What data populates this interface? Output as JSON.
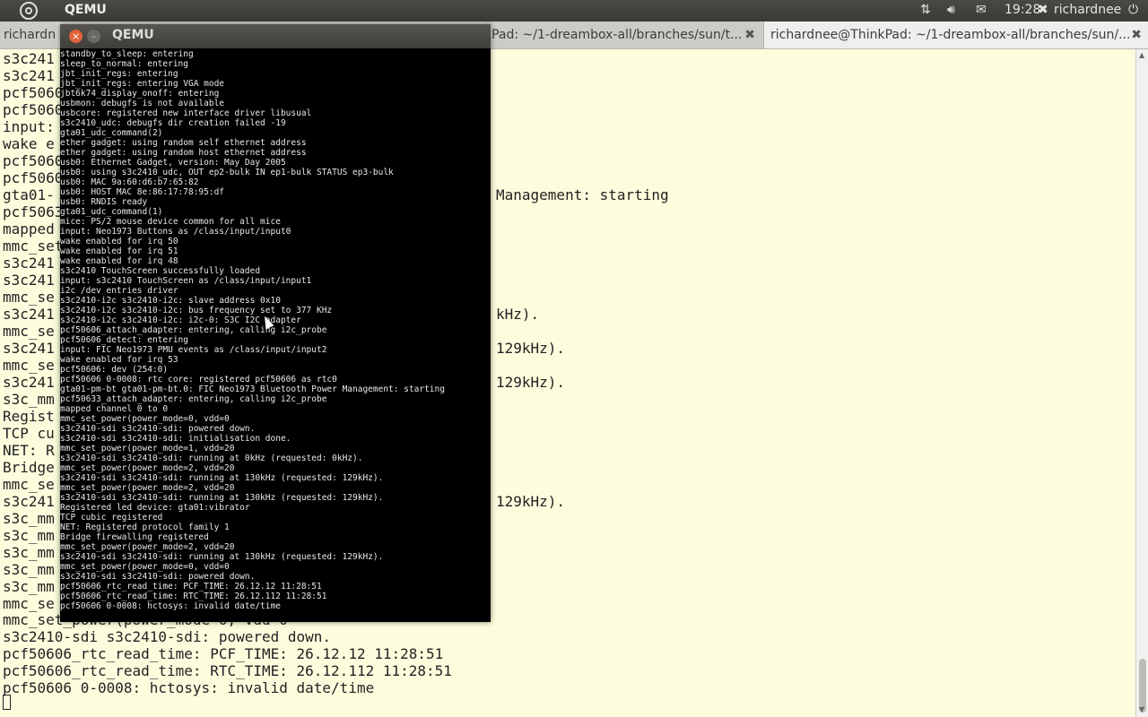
{
  "topbar": {
    "app_name": "QEMU",
    "time": "19:28",
    "user": "richardnee",
    "icons": [
      "ubuntu-logo-icon",
      "network-icon",
      "volume-icon",
      "mail-icon",
      "user-icon",
      "power-icon"
    ]
  },
  "tabs": [
    {
      "label": "richardne",
      "close": "×"
    },
    {
      "label": "kPad: ~/1-dreambox-all/branches/sun/t...",
      "close": "✖"
    },
    {
      "label": "richardnee@ThinkPad: ~/1-dreambox-all/branches/sun/...",
      "close": "✖"
    }
  ],
  "background_terminal": {
    "left_lines": [
      "s3c241",
      "s3c241",
      "pcf5060",
      "pcf5060",
      "input:",
      "wake e",
      "pcf5060",
      "pcf5060",
      "gta01-",
      "pcf5063",
      "mapped",
      "mmc_set",
      "s3c241",
      "s3c241",
      "mmc_se",
      "s3c241",
      "mmc_se",
      "s3c241",
      "mmc_se",
      "s3c241",
      "s3c_mm",
      "Regist",
      "TCP cu",
      "NET: R",
      "Bridge",
      "mmc_se",
      "s3c241",
      "s3c_mm",
      "s3c_mm",
      "s3c_mm",
      "s3c_mm",
      "s3c_mm",
      "mmc_se"
    ],
    "right_fragments": [
      {
        "row": 8,
        "text": "Management: starting"
      },
      {
        "row": 15,
        "text": "kHz)."
      },
      {
        "row": 17,
        "text": "129kHz)."
      },
      {
        "row": 19,
        "text": "129kHz)."
      },
      {
        "row": 26,
        "text": "129kHz)."
      }
    ],
    "bottom_lines": [
      "mmc_set_power(power_mode=0, vdd=0",
      "s3c2410-sdi s3c2410-sdi: powered down.",
      "pcf50606_rtc_read_time: PCF_TIME: 26.12.12 11:28:51",
      "pcf50606_rtc_read_time: RTC_TIME: 26.12.112 11:28:51",
      "pcf50606 0-0008: hctosys: invalid date/time"
    ]
  },
  "qemu": {
    "title": "QEMU",
    "close": "×",
    "minimize": "–",
    "console_lines": [
      "standby_to_sleep: entering",
      "sleep_to_normal: entering",
      "jbt_init_regs: entering",
      "jbt_init_regs: entering VGA mode",
      "jbt6k74_display_onoff: entering",
      "usbmon: debugfs is not available",
      "usbcore: registered new interface driver libusual",
      "s3c2410_udc: debugfs dir creation failed -19",
      "gta01_udc_command(2)",
      "ether gadget: using random self ethernet address",
      "ether gadget: using random host ethernet address",
      "usb0: Ethernet Gadget, version: May Day 2005",
      "usb0: using s3c2410_udc, OUT ep2-bulk IN ep1-bulk STATUS ep3-bulk",
      "usb0: MAC 9a:60:d6:b7:65:82",
      "usb0: HOST MAC 8e:86:17:78:95:df",
      "usb0: RNDIS ready",
      "gta01_udc_command(1)",
      "mice: PS/2 mouse device common for all mice",
      "input: Neo1973 Buttons as /class/input/input0",
      "wake enabled for irq 50",
      "wake enabled for irq 51",
      "wake enabled for irq 48",
      "s3c2410 TouchScreen successfully loaded",
      "input: s3c2410 TouchScreen as /class/input/input1",
      "i2c /dev entries driver",
      "s3c2410-i2c s3c2410-i2c: slave address 0x10",
      "s3c2410-i2c s3c2410-i2c: bus frequency set to 377 KHz",
      "s3c2410-i2c s3c2410-i2c: i2c-0: S3C I2C adapter",
      "pcf50606_attach_adapter: entering, calling i2c_probe",
      "pcf50606_detect: entering",
      "input: FIC Neo1973 PMU events as /class/input/input2",
      "wake enabled for irq 53",
      "pcf50606: dev (254:0)",
      "pcf50606 0-0008: rtc core: registered pcf50606 as rtc0",
      "gta01-pm-bt gta01-pm-bt.0: FIC Neo1973 Bluetooth Power Management: starting",
      "pcf50633_attach_adapter: entering, calling i2c_probe",
      "mapped channel 0 to 0",
      "mmc_set_power(power_mode=0, vdd=0",
      "s3c2410-sdi s3c2410-sdi: powered down.",
      "s3c2410-sdi s3c2410-sdi: initialisation done.",
      "mmc_set_power(power_mode=1, vdd=20",
      "s3c2410-sdi s3c2410-sdi: running at 0kHz (requested: 0kHz).",
      "mmc_set_power(power_mode=2, vdd=20",
      "s3c2410-sdi s3c2410-sdi: running at 130kHz (requested: 129kHz).",
      "mmc_set_power(power_mode=2, vdd=20",
      "s3c2410-sdi s3c2410-sdi: running at 130kHz (requested: 129kHz).",
      "Registered led device: gta01:vibrator",
      "TCP cubic registered",
      "NET: Registered protocol family 1",
      "Bridge firewalling registered",
      "mmc_set_power(power_mode=2, vdd=20",
      "s3c2410-sdi s3c2410-sdi: running at 130kHz (requested: 129kHz).",
      "mmc_set_power(power_mode=0, vdd=0",
      "s3c2410-sdi s3c2410-sdi: powered down.",
      "pcf50606_rtc_read_time: PCF_TIME: 26.12.12 11:28:51",
      "pcf50606_rtc_read_time: RTC_TIME: 26.12.112 11:28:51",
      "pcf50606 0-0008: hctosys: invalid date/time"
    ]
  }
}
